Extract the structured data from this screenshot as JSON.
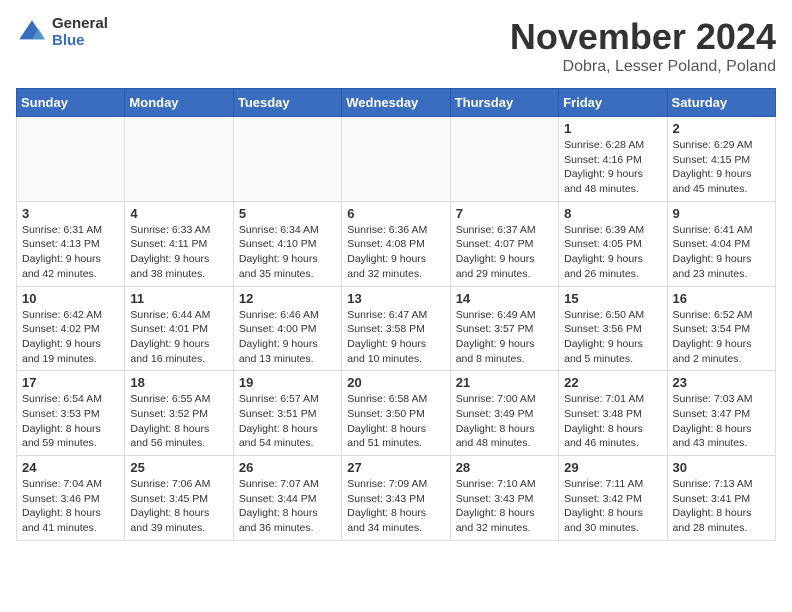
{
  "header": {
    "logo_general": "General",
    "logo_blue": "Blue",
    "month_title": "November 2024",
    "location": "Dobra, Lesser Poland, Poland"
  },
  "weekdays": [
    "Sunday",
    "Monday",
    "Tuesday",
    "Wednesday",
    "Thursday",
    "Friday",
    "Saturday"
  ],
  "weeks": [
    [
      {
        "day": "",
        "info": ""
      },
      {
        "day": "",
        "info": ""
      },
      {
        "day": "",
        "info": ""
      },
      {
        "day": "",
        "info": ""
      },
      {
        "day": "",
        "info": ""
      },
      {
        "day": "1",
        "info": "Sunrise: 6:28 AM\nSunset: 4:16 PM\nDaylight: 9 hours\nand 48 minutes."
      },
      {
        "day": "2",
        "info": "Sunrise: 6:29 AM\nSunset: 4:15 PM\nDaylight: 9 hours\nand 45 minutes."
      }
    ],
    [
      {
        "day": "3",
        "info": "Sunrise: 6:31 AM\nSunset: 4:13 PM\nDaylight: 9 hours\nand 42 minutes."
      },
      {
        "day": "4",
        "info": "Sunrise: 6:33 AM\nSunset: 4:11 PM\nDaylight: 9 hours\nand 38 minutes."
      },
      {
        "day": "5",
        "info": "Sunrise: 6:34 AM\nSunset: 4:10 PM\nDaylight: 9 hours\nand 35 minutes."
      },
      {
        "day": "6",
        "info": "Sunrise: 6:36 AM\nSunset: 4:08 PM\nDaylight: 9 hours\nand 32 minutes."
      },
      {
        "day": "7",
        "info": "Sunrise: 6:37 AM\nSunset: 4:07 PM\nDaylight: 9 hours\nand 29 minutes."
      },
      {
        "day": "8",
        "info": "Sunrise: 6:39 AM\nSunset: 4:05 PM\nDaylight: 9 hours\nand 26 minutes."
      },
      {
        "day": "9",
        "info": "Sunrise: 6:41 AM\nSunset: 4:04 PM\nDaylight: 9 hours\nand 23 minutes."
      }
    ],
    [
      {
        "day": "10",
        "info": "Sunrise: 6:42 AM\nSunset: 4:02 PM\nDaylight: 9 hours\nand 19 minutes."
      },
      {
        "day": "11",
        "info": "Sunrise: 6:44 AM\nSunset: 4:01 PM\nDaylight: 9 hours\nand 16 minutes."
      },
      {
        "day": "12",
        "info": "Sunrise: 6:46 AM\nSunset: 4:00 PM\nDaylight: 9 hours\nand 13 minutes."
      },
      {
        "day": "13",
        "info": "Sunrise: 6:47 AM\nSunset: 3:58 PM\nDaylight: 9 hours\nand 10 minutes."
      },
      {
        "day": "14",
        "info": "Sunrise: 6:49 AM\nSunset: 3:57 PM\nDaylight: 9 hours\nand 8 minutes."
      },
      {
        "day": "15",
        "info": "Sunrise: 6:50 AM\nSunset: 3:56 PM\nDaylight: 9 hours\nand 5 minutes."
      },
      {
        "day": "16",
        "info": "Sunrise: 6:52 AM\nSunset: 3:54 PM\nDaylight: 9 hours\nand 2 minutes."
      }
    ],
    [
      {
        "day": "17",
        "info": "Sunrise: 6:54 AM\nSunset: 3:53 PM\nDaylight: 8 hours\nand 59 minutes."
      },
      {
        "day": "18",
        "info": "Sunrise: 6:55 AM\nSunset: 3:52 PM\nDaylight: 8 hours\nand 56 minutes."
      },
      {
        "day": "19",
        "info": "Sunrise: 6:57 AM\nSunset: 3:51 PM\nDaylight: 8 hours\nand 54 minutes."
      },
      {
        "day": "20",
        "info": "Sunrise: 6:58 AM\nSunset: 3:50 PM\nDaylight: 8 hours\nand 51 minutes."
      },
      {
        "day": "21",
        "info": "Sunrise: 7:00 AM\nSunset: 3:49 PM\nDaylight: 8 hours\nand 48 minutes."
      },
      {
        "day": "22",
        "info": "Sunrise: 7:01 AM\nSunset: 3:48 PM\nDaylight: 8 hours\nand 46 minutes."
      },
      {
        "day": "23",
        "info": "Sunrise: 7:03 AM\nSunset: 3:47 PM\nDaylight: 8 hours\nand 43 minutes."
      }
    ],
    [
      {
        "day": "24",
        "info": "Sunrise: 7:04 AM\nSunset: 3:46 PM\nDaylight: 8 hours\nand 41 minutes."
      },
      {
        "day": "25",
        "info": "Sunrise: 7:06 AM\nSunset: 3:45 PM\nDaylight: 8 hours\nand 39 minutes."
      },
      {
        "day": "26",
        "info": "Sunrise: 7:07 AM\nSunset: 3:44 PM\nDaylight: 8 hours\nand 36 minutes."
      },
      {
        "day": "27",
        "info": "Sunrise: 7:09 AM\nSunset: 3:43 PM\nDaylight: 8 hours\nand 34 minutes."
      },
      {
        "day": "28",
        "info": "Sunrise: 7:10 AM\nSunset: 3:43 PM\nDaylight: 8 hours\nand 32 minutes."
      },
      {
        "day": "29",
        "info": "Sunrise: 7:11 AM\nSunset: 3:42 PM\nDaylight: 8 hours\nand 30 minutes."
      },
      {
        "day": "30",
        "info": "Sunrise: 7:13 AM\nSunset: 3:41 PM\nDaylight: 8 hours\nand 28 minutes."
      }
    ]
  ]
}
